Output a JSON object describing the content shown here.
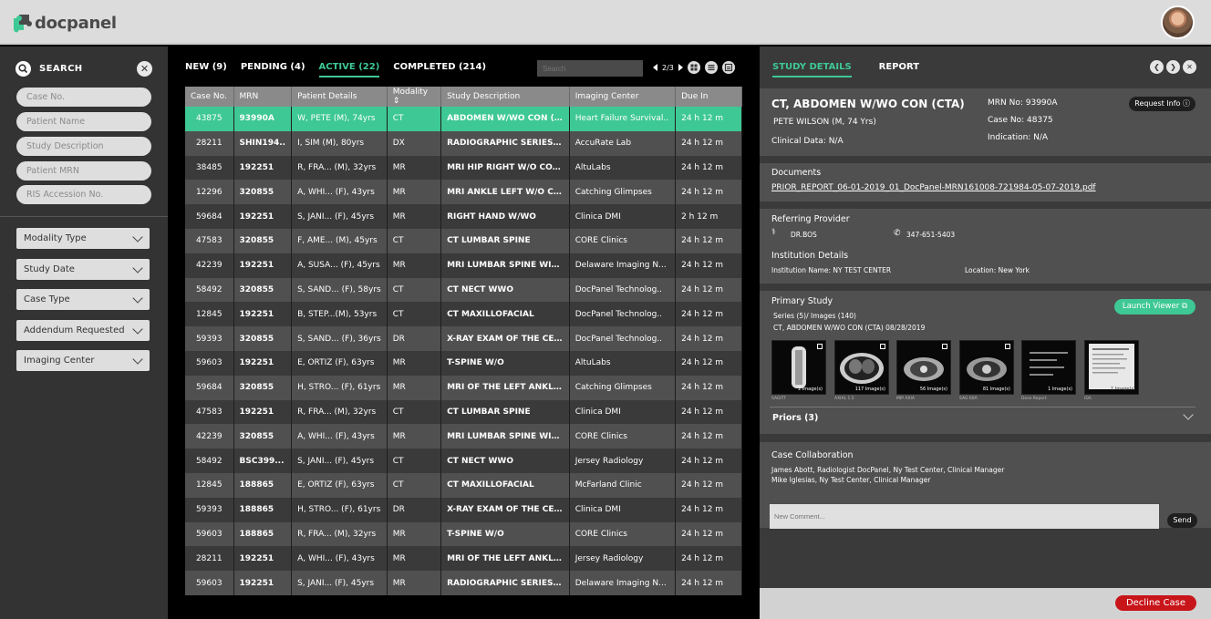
{
  "app": {
    "logo_text": "docpanel"
  },
  "search": {
    "title": "SEARCH",
    "fields": [
      "Case No.",
      "Patient Name",
      "Study Description",
      "Patient MRN",
      "RIS Accession No."
    ],
    "filters": [
      "Modality Type",
      "Study Date",
      "Case Type",
      "Addendum Requested",
      "Imaging Center"
    ]
  },
  "worklist": {
    "tabs": [
      "NEW (9)",
      "PENDING (4)",
      "ACTIVE (22)",
      "COMPLETED (214)"
    ],
    "search_placeholder": "Search",
    "page": "2/3",
    "columns": [
      "Case No.",
      "MRN",
      "Patient Details",
      "Modality ⇕",
      "Study Description",
      "Imaging Center",
      "Due In"
    ],
    "rows": [
      [
        "43875",
        "93990A",
        "W, PETE (M), 74yrs",
        "CT",
        "ABDOMEN W/WO CON (CTA)",
        "Heart Failure Survival..",
        "24 h 12 m"
      ],
      [
        "28211",
        "SHIN194..",
        "I, SIM (M), 80yrs",
        "DX",
        "RADIOGRAPHIC SERIES CE...",
        "AccuRate Lab",
        "24 h 12 m"
      ],
      [
        "38485",
        "192251",
        "R, FRA... (M), 32yrs",
        "MR",
        "MRI HIP RIGHT W/O CONTR...",
        "AltuLabs",
        "24 h 12 m"
      ],
      [
        "12296",
        "320855",
        "A, WHI... (F), 43yrs",
        "MR",
        "MRI ANKLE LEFT W/O CONT...",
        "Catching Glimpses",
        "24 h 12 m"
      ],
      [
        "59684",
        "192251",
        "S, JANI... (F), 45yrs",
        "MR",
        "RIGHT HAND W/WO",
        "Clinica DMI",
        "2 h 12 m"
      ],
      [
        "47583",
        "320855",
        "F, AME... (M), 45yrs",
        "CT",
        "CT LUMBAR SPINE",
        "CORE Clinics",
        "24 h 12 m"
      ],
      [
        "42239",
        "192251",
        "A, SUSA... (F), 45yrs",
        "MR",
        "MRI LUMBAR SPINE WIT...",
        "Delaware Imaging N...",
        "24 h 12 m"
      ],
      [
        "58492",
        "320855",
        "S, SAND... (F), 58yrs",
        "CT",
        "CT NECT WWO",
        "DocPanel Technolog..",
        "24 h 12 m"
      ],
      [
        "12845",
        "192251",
        "B, STEP...(M), 53yrs",
        "CT",
        "CT MAXILLOFACIAL",
        "DocPanel Technolog..",
        "24 h 12 m"
      ],
      [
        "59393",
        "320855",
        "S, SAND... (F), 36yrs",
        "DR",
        "X-RAY EXAM OF THE CERV...",
        "DocPanel Technolog..",
        "24 h 12 m"
      ],
      [
        "59603",
        "192251",
        "E, ORTIZ (F), 63yrs",
        "MR",
        "T-SPINE W/O",
        "AltuLabs",
        "24 h 12 m"
      ],
      [
        "59684",
        "320855",
        "H, STRO... (F), 61yrs",
        "MR",
        "MRI OF THE LEFT ANKLE W...",
        "Catching Glimpses",
        "24 h 12 m"
      ],
      [
        "47583",
        "192251",
        "R, FRA... (M), 32yrs",
        "CT",
        "CT LUMBAR SPINE",
        "Clinica DMI",
        "24 h 12 m"
      ],
      [
        "42239",
        "320855",
        "A, WHI... (F), 43yrs",
        "MR",
        "MRI LUMBAR SPINE WIT...",
        "CORE Clinics",
        "24 h 12 m"
      ],
      [
        "58492",
        "BSC399...",
        "S, JANI... (F), 45yrs",
        "CT",
        "CT NECT WWO",
        "Jersey Radiology",
        "24 h 12 m"
      ],
      [
        "12845",
        "188865",
        "E, ORTIZ (F), 63yrs",
        "CT",
        "CT MAXILLOFACIAL",
        "McFarland Clinic",
        "24 h 12 m"
      ],
      [
        "59393",
        "188865",
        "H, STRO... (F), 61yrs",
        "DR",
        "X-RAY EXAM OF THE CERV...",
        "Clinica DMI",
        "24 h 12 m"
      ],
      [
        "59603",
        "188865",
        "R, FRA... (M), 32yrs",
        "MR",
        "T-SPINE W/O",
        "CORE Clinics",
        "24 h 12 m"
      ],
      [
        "28211",
        "192251",
        "A, WHI... (F), 43yrs",
        "MR",
        "MRI OF THE LEFT ANKLE W...",
        "Jersey Radiology",
        "24 h 12 m"
      ],
      [
        "59603",
        "192251",
        "S, JANI... (F), 45yrs",
        "MR",
        "RADIOGRAPHIC SERIES CE...",
        "Delaware Imaging N...",
        "24 h 12 m"
      ]
    ]
  },
  "details": {
    "tabs": [
      "STUDY DETAILS",
      "REPORT"
    ],
    "study_title": "CT, ABDOMEN W/WO CON (CTA)",
    "patient": "PETE WILSON  (M, 74 Yrs)",
    "clinical": "Clinical Data: N/A",
    "mrn": "MRN No: 93990A",
    "case_no": "Case No: 48375",
    "indication": "Indication: N/A",
    "request_info": "Request Info ⓘ",
    "documents_title": "Documents",
    "document_link": "PRIOR_REPORT_06-01-2019_01_DocPanel-MRN161008-721984-05-07-2019.pdf",
    "referring_title": "Referring Provider",
    "referring_name": "DR.BOS",
    "referring_phone": "347-651-5403",
    "institution_title": "Institution Details",
    "institution_name": "Institution Name: NY TEST CENTER",
    "institution_location": "Location: New York",
    "primary_title": "Primary Study",
    "series_info": "Series (5)/ Images (140)",
    "study_line": "CT, ABDOMEN W/WO CON (CTA)  08/28/2019",
    "launch": "Launch Viewer ⧉",
    "thumbs": [
      {
        "count": "2 Image(s)",
        "cap": "SAGITT"
      },
      {
        "count": "117 Image(s)",
        "cap": "AXIAL 1.5"
      },
      {
        "count": "56 Image(s)",
        "cap": "MIP AXIA"
      },
      {
        "count": "81 Image(s)",
        "cap": "SAG 60A"
      },
      {
        "count": "1 Image(s)",
        "cap": "Dose Report"
      },
      {
        "count": "1 Image(s)",
        "cap": "IDA"
      }
    ],
    "priors": "Priors (3)",
    "collab_title": "Case Collaboration",
    "collab_1": "James Abott, Radiologist   DocPanel, Ny Test Center, Clinical Manager",
    "collab_2": "Mike Iglesias, Ny Test Center, Clinical Manager",
    "comment_placeholder": "New Comment...",
    "send": "Send",
    "decline": "Decline Case"
  }
}
